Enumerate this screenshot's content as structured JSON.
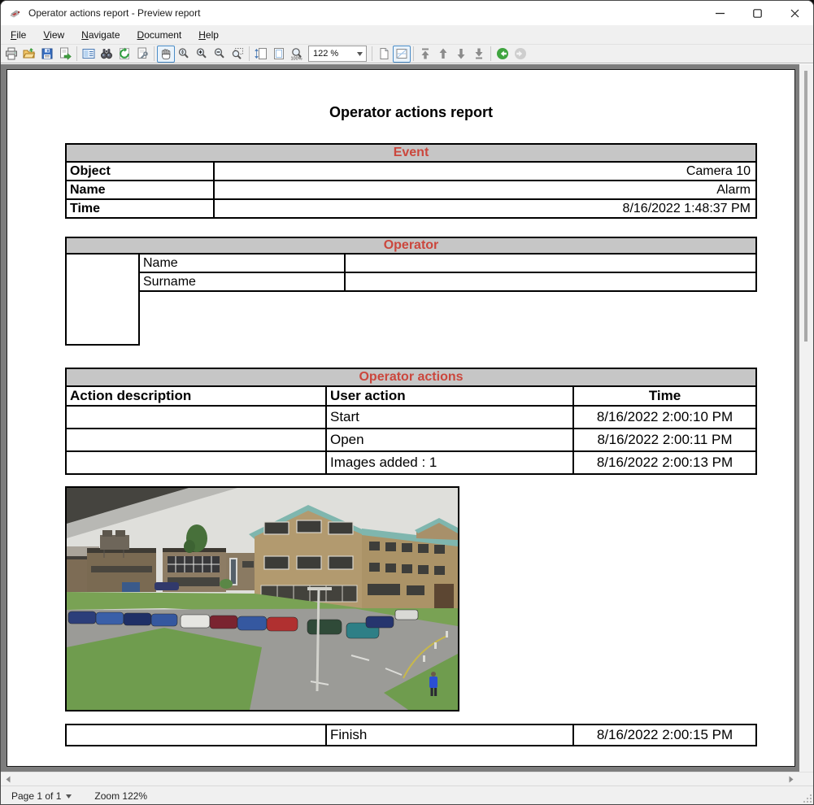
{
  "window": {
    "title": "Operator actions report - Preview report",
    "controls": {
      "minimize": "minimize",
      "maximize": "maximize",
      "close": "close"
    }
  },
  "menu": {
    "items": [
      {
        "accel": "F",
        "rest": "ile"
      },
      {
        "accel": "V",
        "rest": "iew"
      },
      {
        "accel": "N",
        "rest": "avigate"
      },
      {
        "accel": "D",
        "rest": "ocument"
      },
      {
        "accel": "H",
        "rest": "elp"
      }
    ]
  },
  "toolbar": {
    "zoom_value": "122 %",
    "buttons": [
      "print",
      "open",
      "save",
      "export",
      "document-options",
      "find",
      "refresh",
      "page-setup",
      "hand-tool",
      "dynamic-zoom",
      "zoom-in",
      "zoom-out",
      "zoom-region",
      "fit-width",
      "fit-page",
      "zoom-100",
      "zoom-combo",
      "single-page-view",
      "whole-page-view",
      "first-page",
      "previous-page",
      "next-page",
      "last-page",
      "back",
      "forward"
    ],
    "selected": [
      "hand-tool",
      "whole-page-view"
    ],
    "disabled": [
      "forward"
    ]
  },
  "report": {
    "title": "Operator actions report",
    "event": {
      "header": "Event",
      "rows": [
        {
          "label": "Object",
          "value": "Camera 10"
        },
        {
          "label": "Name",
          "value": "Alarm"
        },
        {
          "label": "Time",
          "value": "8/16/2022 1:48:37 PM"
        }
      ]
    },
    "operator": {
      "header": "Operator",
      "fields": [
        {
          "label": "Name",
          "value": ""
        },
        {
          "label": "Surname",
          "value": ""
        }
      ]
    },
    "actions": {
      "header": "Operator actions",
      "columns": [
        "Action description",
        "User action",
        "Time"
      ],
      "rows": [
        {
          "description": "",
          "action": "Start",
          "time": "8/16/2022 2:00:10 PM"
        },
        {
          "description": "",
          "action": "Open",
          "time": "8/16/2022 2:00:11 PM"
        },
        {
          "description": "",
          "action": "Images added : 1",
          "time": "8/16/2022 2:00:13 PM"
        }
      ],
      "finish_row": {
        "description": "",
        "action": "Finish",
        "time": "8/16/2022 2:00:15 PM"
      }
    },
    "camera_image": "cctv-snapshot-office-building-parking-lot"
  },
  "statusbar": {
    "page": "Page 1 of 1",
    "zoom": "Zoom 122%"
  },
  "colors": {
    "section_header_bg": "#c6c6c6",
    "section_header_text": "#cb473d",
    "preview_background": "#7d7d7d",
    "selection_blue": "#4a8cc7"
  }
}
